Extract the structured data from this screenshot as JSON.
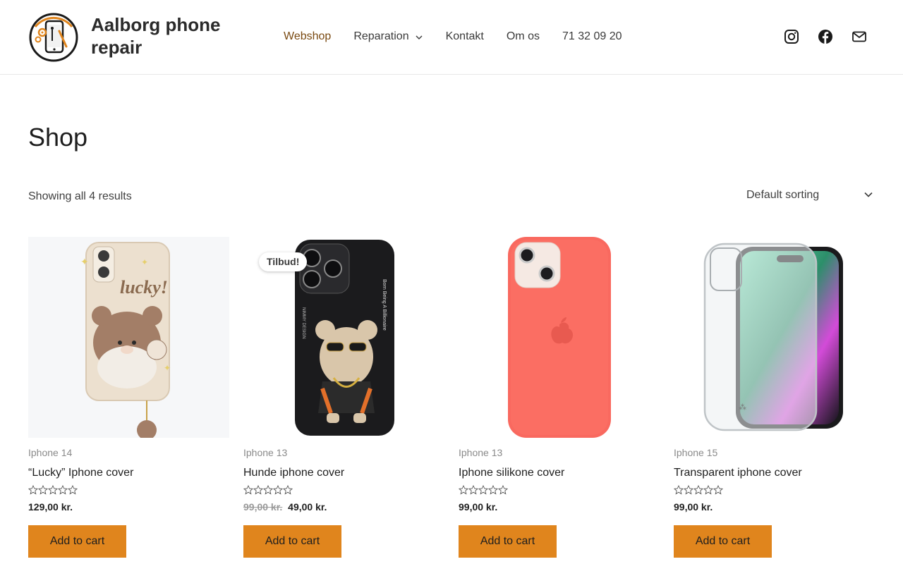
{
  "site": {
    "title": "Aalborg phone repair",
    "accent": "#e0851d",
    "nav_active_color": "#7a4a12"
  },
  "nav": {
    "items": [
      {
        "label": "Webshop",
        "active": true
      },
      {
        "label": "Reparation",
        "has_dropdown": true
      },
      {
        "label": "Kontakt"
      },
      {
        "label": "Om os"
      },
      {
        "label": "71 32 09 20"
      }
    ]
  },
  "social": [
    {
      "icon": "instagram-icon"
    },
    {
      "icon": "facebook-icon"
    },
    {
      "icon": "mail-icon"
    }
  ],
  "shop": {
    "title": "Shop",
    "result_count": "Showing all 4 results",
    "sorting": "Default sorting"
  },
  "products": [
    {
      "category": "Iphone 14",
      "name": "“Lucky” Iphone cover",
      "price": "129,00 kr.",
      "old_price": "",
      "button": "Add to cart",
      "rating": 0
    },
    {
      "category": "Iphone 13",
      "name": "Hunde iphone cover",
      "price": "49,00 kr.",
      "old_price": "99,00 kr.",
      "badge": "Tilbud!",
      "button": "Add to cart",
      "rating": 0
    },
    {
      "category": "Iphone 13",
      "name": "Iphone silikone cover",
      "price": "99,00 kr.",
      "old_price": "",
      "button": "Add to cart",
      "rating": 0
    },
    {
      "category": "Iphone 15",
      "name": "Transparent iphone cover",
      "price": "99,00 kr.",
      "old_price": "",
      "button": "Add to cart",
      "rating": 0
    }
  ]
}
